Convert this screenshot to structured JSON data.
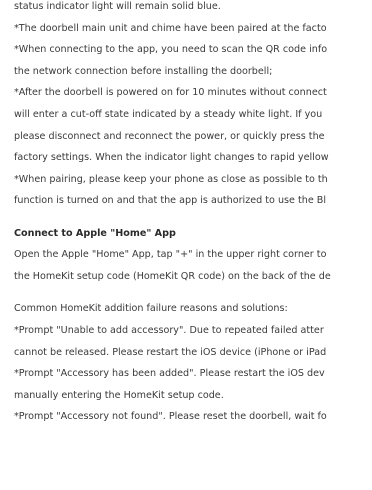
{
  "lines": [
    {
      "type": "text",
      "text": "status indicator light will remain solid blue."
    },
    {
      "type": "text",
      "text": "*The doorbell main unit and chime have been paired at the facto"
    },
    {
      "type": "text",
      "text": "*When connecting to the app, you need to scan the QR code info"
    },
    {
      "type": "text",
      "text": "the network connection before installing the doorbell;"
    },
    {
      "type": "text",
      "text": "*After the doorbell is powered on for 10 minutes without connect"
    },
    {
      "type": "text",
      "text": "will enter a cut-off state indicated by a  steady white light. If you"
    },
    {
      "type": "text",
      "text": "please disconnect and reconnect the power, or quickly press the"
    },
    {
      "type": "text",
      "text": "factory settings. When the indicator light changes to rapid yellow"
    },
    {
      "type": "text",
      "text": "*When pairing, please keep your phone as close as possible to th"
    },
    {
      "type": "text",
      "text": "function is turned on and that the app is authorized to use the Bl"
    },
    {
      "type": "gap"
    },
    {
      "type": "heading",
      "text": "Connect to Apple \"Home\" App"
    },
    {
      "type": "text",
      "text": "Open the Apple \"Home\" App, tap \"+\" in the upper right corner to"
    },
    {
      "type": "text",
      "text": "the HomeKit setup code (HomeKit QR code) on the back of the de"
    },
    {
      "type": "gap"
    },
    {
      "type": "text",
      "text": "Common HomeKit addition failure reasons and solutions:"
    },
    {
      "type": "text",
      "text": "*Prompt \"Unable to add accessory\". Due to repeated failed atter"
    },
    {
      "type": "text",
      "text": "cannot be released. Please restart the iOS device (iPhone or iPad"
    },
    {
      "type": "text",
      "text": "*Prompt \"Accessory has been added\". Please restart the iOS dev"
    },
    {
      "type": "text",
      "text": "manually entering the HomeKit setup code."
    },
    {
      "type": "text",
      "text": "*Prompt \"Accessory not found\". Please reset the doorbell, wait fo"
    }
  ]
}
